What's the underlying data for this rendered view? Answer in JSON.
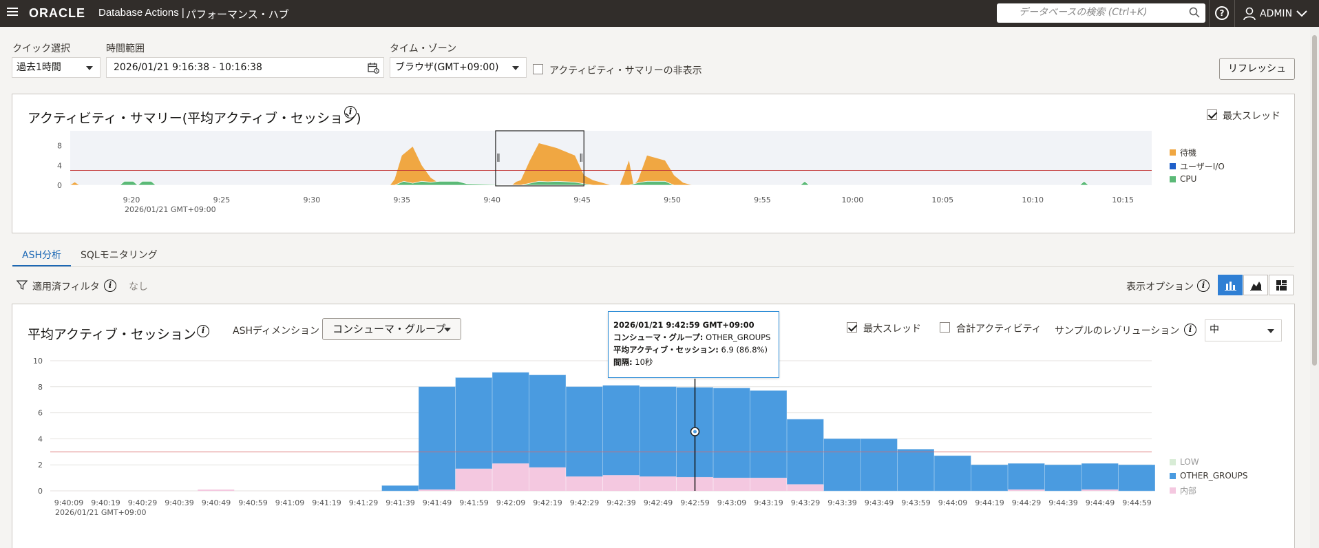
{
  "header": {
    "brand": "ORACLE",
    "app_title": "Database Actions |",
    "page_title": "パフォーマンス・ハブ",
    "search_placeholder": "データベースの検索 (Ctrl+K)",
    "user": "ADMIN"
  },
  "controls": {
    "quick_select_label": "クイック選択",
    "quick_select_value": "過去1時間",
    "time_range_label": "時間範囲",
    "time_range_value": "2026/01/21 9:16:38 - 10:16:38",
    "timezone_label": "タイム・ゾーン",
    "timezone_value": "ブラウザ(GMT+09:00)",
    "hide_summary_label": "アクティビティ・サマリーの非表示",
    "hide_summary_checked": false,
    "refresh_label": "リフレッシュ"
  },
  "activity_summary": {
    "title": "アクティビティ・サマリー(平均アクティブ・セッション)",
    "max_threads_label": "最大スレッド",
    "max_threads_checked": true,
    "legend": [
      {
        "name": "待機",
        "color": "#f0a742"
      },
      {
        "name": "ユーザーI/O",
        "color": "#1f5fc9"
      },
      {
        "name": "CPU",
        "color": "#5bb977"
      }
    ],
    "date_label": "2026/01/21 GMT+09:00"
  },
  "tabs": [
    {
      "label": "ASH分析",
      "active": true
    },
    {
      "label": "SQLモニタリング",
      "active": false
    }
  ],
  "filters": {
    "label": "適用済フィルタ",
    "value": "なし",
    "display_options_label": "表示オプション"
  },
  "ash_panel": {
    "title": "平均アクティブ・セッション",
    "dimension_label": "ASHディメンション",
    "dimension_value": "コンシューマ・グループ",
    "max_threads_label": "最大スレッド",
    "max_threads_checked": true,
    "total_activity_label": "合計アクティビティ",
    "total_activity_checked": false,
    "resolution_label": "サンプルのレゾリューション",
    "resolution_value": "中",
    "date_label": "2026/01/21 GMT+09:00",
    "legend": [
      {
        "name": "LOW",
        "color": "#d8ecd6"
      },
      {
        "name": "OTHER_GROUPS",
        "color": "#4a9be0"
      },
      {
        "name": "内部",
        "color": "#f4c8e0"
      }
    ],
    "tooltip": {
      "time": "2026/01/21 9:42:59 GMT+09:00",
      "line1_key": "コンシューマ・グループ:",
      "line1_val": "OTHER_GROUPS",
      "line2_key": "平均アクティブ・セッション:",
      "line2_val": "6.9 (86.8%)",
      "line3_key": "間隔:",
      "line3_val": "10秒"
    }
  },
  "chart_data": [
    {
      "type": "area",
      "title": "アクティビティ・サマリー(平均アクティブ・セッション)",
      "x_ticks": [
        "9:20",
        "9:25",
        "9:30",
        "9:35",
        "9:40",
        "9:45",
        "9:50",
        "9:55",
        "10:00",
        "10:05",
        "10:10",
        "10:15"
      ],
      "y_ticks": [
        0,
        4,
        8
      ],
      "ylim": [
        0,
        11
      ],
      "threshold": 3,
      "series": [
        {
          "name": "待機",
          "points": [
            [
              0,
              0
            ],
            [
              0.5,
              0.6
            ],
            [
              1,
              0
            ],
            [
              35.5,
              0
            ],
            [
              36,
              1.2
            ],
            [
              36.8,
              6
            ],
            [
              38,
              7.8
            ],
            [
              39,
              4
            ],
            [
              40,
              1.5
            ],
            [
              41,
              0.3
            ],
            [
              42,
              0
            ],
            [
              49,
              0
            ],
            [
              49.5,
              0.7
            ],
            [
              50,
              1
            ],
            [
              51,
              5
            ],
            [
              52,
              8.5
            ],
            [
              53,
              8
            ],
            [
              54,
              7.5
            ],
            [
              56,
              6
            ],
            [
              57,
              2
            ],
            [
              58,
              1
            ],
            [
              59,
              0.5
            ],
            [
              60,
              0
            ],
            [
              61,
              0
            ],
            [
              62,
              5
            ],
            [
              62.5,
              0
            ],
            [
              63,
              1
            ],
            [
              64,
              6
            ],
            [
              65,
              5.5
            ],
            [
              66,
              5
            ],
            [
              67,
              2
            ],
            [
              68,
              0.5
            ],
            [
              69,
              0
            ]
          ]
        },
        {
          "name": "ユーザーI/O",
          "points": [
            [
              0,
              0
            ],
            [
              50,
              0
            ],
            [
              52,
              0.3
            ],
            [
              54,
              0
            ],
            [
              69,
              0
            ]
          ]
        },
        {
          "name": "CPU",
          "points": [
            [
              0,
              0
            ],
            [
              5.5,
              0
            ],
            [
              6,
              0.8
            ],
            [
              7,
              0.8
            ],
            [
              7.5,
              0
            ],
            [
              8,
              0.8
            ],
            [
              9,
              0.8
            ],
            [
              9.5,
              0
            ],
            [
              10,
              0
            ],
            [
              36,
              0
            ],
            [
              37,
              0.8
            ],
            [
              38,
              0.4
            ],
            [
              39,
              0.8
            ],
            [
              40,
              0.6
            ],
            [
              41,
              0.8
            ],
            [
              42,
              0.8
            ],
            [
              43,
              0.8
            ],
            [
              44,
              0.3
            ],
            [
              50,
              0
            ],
            [
              51,
              0.4
            ],
            [
              52,
              0.8
            ],
            [
              53,
              0.7
            ],
            [
              54,
              0.8
            ],
            [
              56,
              0.6
            ],
            [
              57,
              0.3
            ],
            [
              58,
              0
            ],
            [
              62,
              0
            ],
            [
              63,
              0.5
            ],
            [
              64,
              0.8
            ],
            [
              65,
              0.8
            ],
            [
              66,
              0.8
            ],
            [
              67,
              0
            ],
            [
              81,
              0
            ],
            [
              81.5,
              0.8
            ],
            [
              82,
              0
            ],
            [
              112,
              0
            ],
            [
              112.5,
              0.8
            ],
            [
              113,
              0
            ]
          ]
        }
      ]
    },
    {
      "type": "bar",
      "title": "平均アクティブ・セッション",
      "categories": [
        "9:40:09",
        "9:40:19",
        "9:40:29",
        "9:40:39",
        "9:40:49",
        "9:40:59",
        "9:41:09",
        "9:41:19",
        "9:41:29",
        "9:41:39",
        "9:41:49",
        "9:41:59",
        "9:42:09",
        "9:42:19",
        "9:42:29",
        "9:42:39",
        "9:42:49",
        "9:42:59",
        "9:43:09",
        "9:43:19",
        "9:43:29",
        "9:43:39",
        "9:43:49",
        "9:43:59",
        "9:44:09",
        "9:44:19",
        "9:44:29",
        "9:44:39",
        "9:44:49",
        "9:44:59"
      ],
      "y_ticks": [
        0,
        2,
        4,
        6,
        8,
        10
      ],
      "ylim": [
        0,
        10
      ],
      "threshold": 3,
      "series": [
        {
          "name": "内部",
          "values": [
            0,
            0,
            0,
            0,
            0.1,
            0,
            0,
            0,
            0,
            0,
            0.1,
            1.7,
            2.1,
            1.8,
            1.1,
            1.2,
            1.1,
            1.05,
            1.0,
            1.0,
            0.5,
            0,
            0,
            0,
            0,
            0,
            0.1,
            0,
            0.1,
            0
          ]
        },
        {
          "name": "OTHER_GROUPS",
          "values": [
            0,
            0,
            0,
            0,
            0,
            0,
            0,
            0,
            0,
            0.4,
            7.9,
            7.0,
            7.0,
            7.1,
            6.9,
            6.9,
            6.9,
            6.9,
            6.9,
            6.7,
            5.0,
            4.0,
            4.0,
            3.2,
            2.7,
            2.0,
            2.0,
            2.0,
            2.0,
            2.0
          ]
        }
      ],
      "cursor_category": "9:42:59"
    }
  ]
}
